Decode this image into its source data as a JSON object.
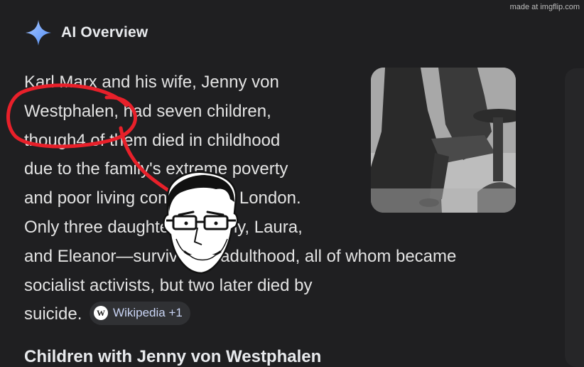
{
  "watermark": "made at imgflip.com",
  "header": {
    "icon": "sparkle-icon",
    "title": "AI Overview"
  },
  "overview": {
    "lines": [
      "Karl Marx and his wife, Jenny von",
      "Westphalen, had seven children,",
      "though4 of them died in childhood",
      "due to the family's extreme poverty",
      "and poor living conditions in London.",
      "Only three daughters—Jenny, Laura,",
      "and Eleanor—survived to adulthood, all of whom became",
      "socialist activists, but two later died by",
      "suicide."
    ],
    "source_chip": {
      "icon": "wikipedia-icon",
      "icon_glyph": "W",
      "label": "Wikipedia +1"
    }
  },
  "next_heading": "Children with Jenny von Westphalen",
  "colors": {
    "background": "#1f1f21",
    "text": "#e3e3e3",
    "annotation_red": "#e8202a",
    "sparkle_gradient": [
      "#4f8df5",
      "#a9c6ff"
    ],
    "chip_bg": "#303134",
    "chip_text": "#c9d4f4"
  }
}
